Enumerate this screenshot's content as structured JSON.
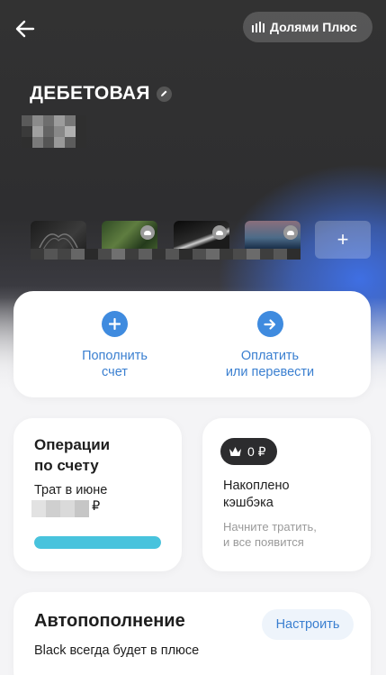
{
  "header": {
    "back_icon": "arrow-left-icon",
    "plus_label": "Долями Плюс",
    "plus_icon": "bars-icon"
  },
  "account": {
    "title": "ДЕБЕТОВАЯ",
    "edit_icon": "pencil-icon"
  },
  "cards": {
    "add_label": "+"
  },
  "actions": [
    {
      "line1": "Пополнить",
      "line2": "счет",
      "icon": "plus-icon"
    },
    {
      "line1": "Оплатить",
      "line2": "или перевести",
      "icon": "arrow-right-icon"
    }
  ],
  "operations": {
    "title_line1": "Операции",
    "title_line2": "по счету",
    "spend_label": "Трат в июне",
    "currency": "₽",
    "progress_fraction": 1.0,
    "progress_color": "#48c3dd"
  },
  "cashback": {
    "badge_value": "0 ₽",
    "badge_icon": "crown-icon",
    "title_line1": "Накоплено",
    "title_line2": "кэшбэка",
    "sub_line1": "Начните тратить,",
    "sub_line2": "и все появится"
  },
  "autotopup": {
    "title": "Автопополнение",
    "subtitle": "Black всегда будет в плюсе",
    "button": "Настроить"
  },
  "colors": {
    "accent": "#3f8bdf",
    "accent_text": "#3a7fd0",
    "hero_dark": "#323232",
    "hero_blue": "#3f6fe3"
  }
}
